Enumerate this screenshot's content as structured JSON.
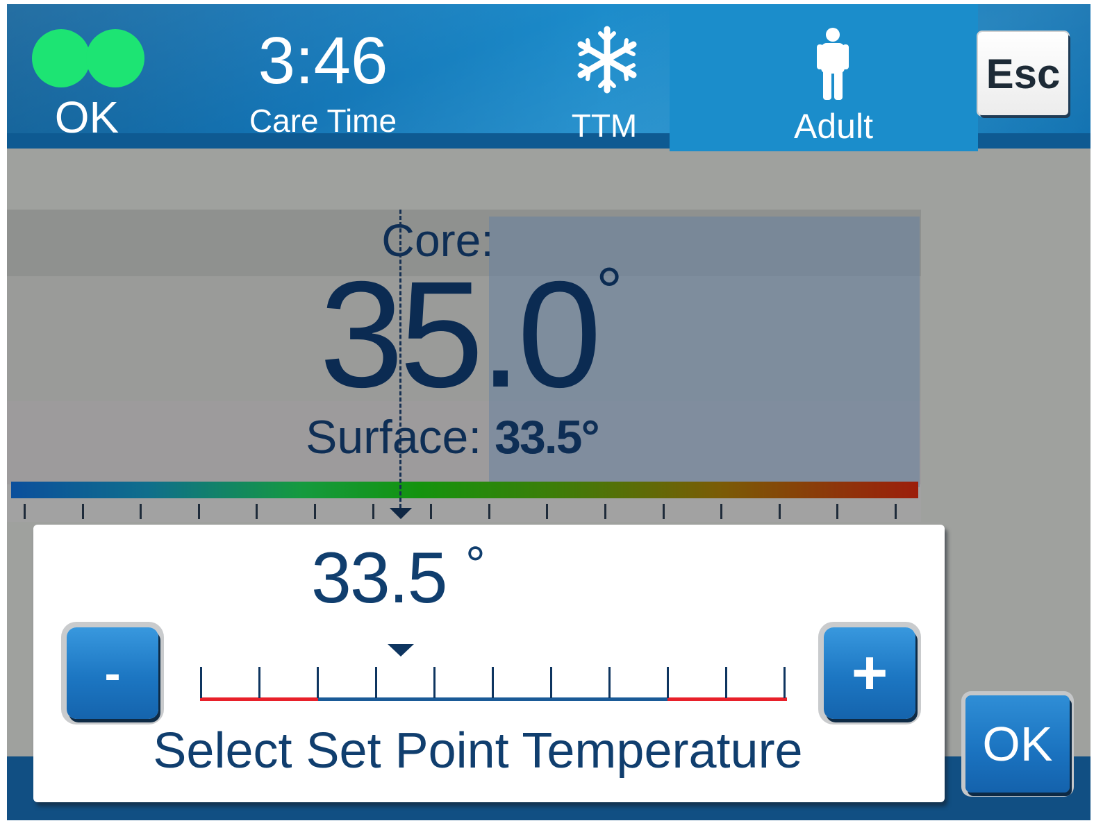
{
  "header": {
    "status_label": "OK",
    "care_time": "3:46",
    "care_time_label": "Care Time",
    "mode_icon": "snowflake-icon",
    "mode_label": "TTM",
    "patient_icon": "person-icon",
    "patient_label": "Adult",
    "esc_label": "Esc"
  },
  "temperature": {
    "core_label": "Core:",
    "core_value": "35.0",
    "degree_symbol": "°",
    "surface_label": "Surface:",
    "surface_value": "33.5°"
  },
  "dialog": {
    "setpoint_value": "33.5",
    "degree_symbol": "°",
    "decrease_label": "-",
    "increase_label": "+",
    "title": "Select Set Point Temperature"
  },
  "ok_button_label": "OK",
  "colors": {
    "status_ok": "#1de473",
    "header_blue": "#1a86c3",
    "text_navy": "#103e6e",
    "limit_red": "#e8202a"
  }
}
